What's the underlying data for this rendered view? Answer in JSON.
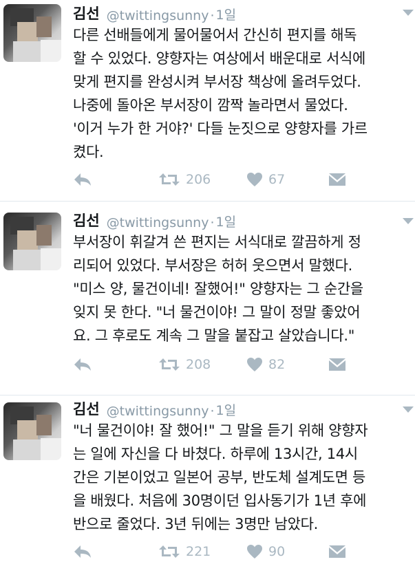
{
  "tweets": [
    {
      "name": "김선",
      "handle": "@twittingsunny",
      "dot": "·",
      "time": "1일",
      "text": "다른 선배들에게 물어물어서 간신히 편지를 해독\n할 수 있었다. 양향자는 여상에서 배운대로 서식에\n맞게 편지를 완성시켜 부서장 책상에 올려두었다.\n나중에 돌아온 부서장이 깜짝 놀라면서 물었다.\n'이거 누가 한 거야?' 다들 눈짓으로 양향자를 가르\n켰다.",
      "retweets": "206",
      "likes": "67"
    },
    {
      "name": "김선",
      "handle": "@twittingsunny",
      "dot": "·",
      "time": "1일",
      "text": "부서장이 휘갈겨 쓴 편지는 서식대로 깔끔하게 정\n리되어 있었다. 부서장은 허허 웃으면서 말했다.\n\"미스 양, 물건이네! 잘했어!\" 양향자는 그 순간을\n잊지 못 한다. \"너 물건이야! 그 말이 정말 좋았어\n요. 그 후로도 계속 그 말을 붙잡고 살았습니다.\"",
      "retweets": "208",
      "likes": "82"
    },
    {
      "name": "김선",
      "handle": "@twittingsunny",
      "dot": "·",
      "time": "1일",
      "text": "\"너 물건이야! 잘 했어!\" 그 말을 듣기 위해 양향자\n는 일에 자신을 다 바쳤다. 하루에 13시간, 14시\n간은 기본이었고 일본어 공부, 반도체 설계도면 등\n을 배웠다. 처음에 30명이던 입사동기가 1년 후에\n반으로 줄었다. 3년 뒤에는 3명만 남았다.",
      "retweets": "221",
      "likes": "90"
    }
  ],
  "icons": {
    "reply": "reply-icon",
    "retweet": "retweet-icon",
    "like": "heart-icon",
    "dm": "envelope-icon",
    "more": "caret-down-icon"
  },
  "colors": {
    "icon": "#aab8c2",
    "meta": "#8899a6",
    "text": "#14171a",
    "divider": "#e1e8ed"
  }
}
